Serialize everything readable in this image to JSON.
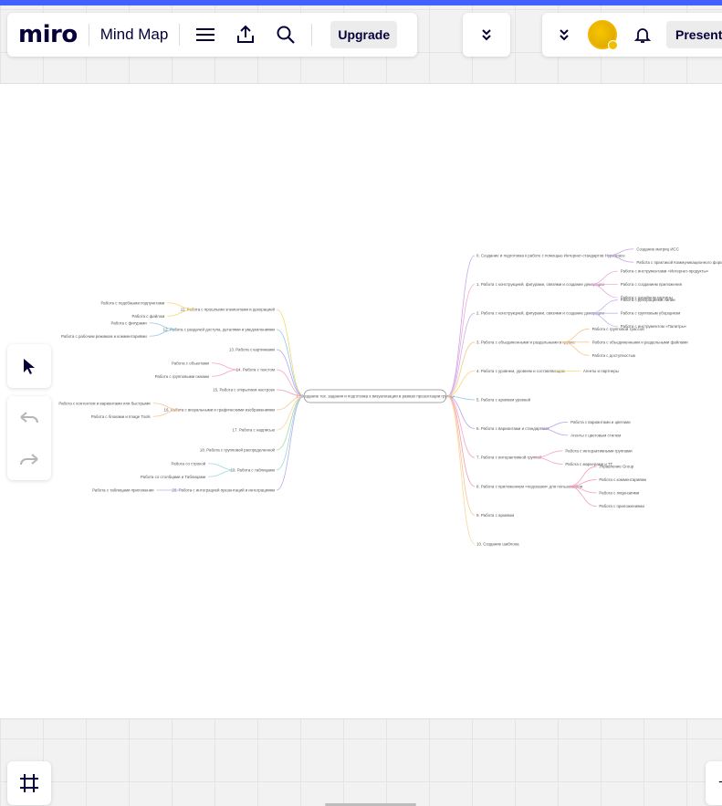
{
  "app": {
    "logo": "miro",
    "board_title": "Mind Map"
  },
  "toolbar": {
    "menu_icon": "hamburger-icon",
    "export_icon": "upload-icon",
    "search_icon": "search-icon",
    "upgrade_label": "Upgrade",
    "collapse_icon": "double-chevron-down-icon"
  },
  "right_toolbar": {
    "collapse_icon": "double-chevron-down-icon",
    "notifications_icon": "bell-icon",
    "present_label": "Present"
  },
  "left_tools": {
    "select_icon": "cursor-icon",
    "undo_icon": "undo-icon",
    "redo_icon": "redo-icon"
  },
  "bottom": {
    "frames_icon": "frames-icon",
    "zoom_label": "+"
  },
  "mindmap": {
    "center": "1. Создание тех. задания и подготовка к визуализации в рамках презентации группы",
    "right": [
      {
        "label": "0. Создание и подготовка к работе с помощью Интернет-стандартов Hypaspace",
        "children": [
          "Создание матриц ИСС",
          "Работа с практикой Коммуникационного формата"
        ]
      },
      {
        "label": "1. Работа с конструкцией, фигурами, связями и создание декорации",
        "children": [
          "Работа с инструментами «Интернет-продукты»",
          "Работа с созданием приложения",
          "Работа с дизайном картины"
        ]
      },
      {
        "label": "2. Работа с конструкцией, фигурами, связями и создание декорации",
        "children": [
          "Работа с декорациями линии",
          "Работа с групповым уборщиком",
          "Работа с инструментом «Палитры»"
        ]
      },
      {
        "label": "3. Работа с объединенными и раздельными в группе",
        "children": [
          "Работа с групповой трассой",
          "Работа с объединенными и раздельными файлами",
          "Работа с доступностью"
        ]
      },
      {
        "label": "4. Работа с уровнем, уровнем и составляющим",
        "children": [
          "Агенты и партнеры"
        ]
      },
      {
        "label": "5. Работа с архивом уровней",
        "children": []
      },
      {
        "label": "6. Работа с вариантами и стандартами",
        "children": [
          "Работа с вариантами и цветами",
          "Агенты с цветовым стилем"
        ]
      },
      {
        "label": "7. Работа с интерактивной группой",
        "children": [
          "Работа с интерактивными группами",
          "Работа с маркерами и ТГ"
        ]
      },
      {
        "label": "8. Работа с приложением «подсказки» для пользователя",
        "children": [
          "Управление Group",
          "Работа с комментариями",
          "Работа с лицензиями",
          "Работа с приложениями"
        ]
      },
      {
        "label": "9. Работа с архивом",
        "children": []
      },
      {
        "label": "10. Создание шаблона",
        "children": []
      }
    ],
    "left": [
      {
        "label": "11. Работа с прошлыми элементами и декорацией",
        "children": [
          "Работа с подобными подпунктами",
          "Работа с файлом"
        ]
      },
      {
        "label": "12. Работа с раздачей доступа, деталями и уведомлениями",
        "children": [
          "Работа с фигурами",
          "Работа с рабочим режимом и комментариями"
        ]
      },
      {
        "label": "13. Работа с картинками",
        "children": []
      },
      {
        "label": "14. Работа с текстом",
        "children": [
          "Работа с объектами",
          "Работа с групповыми окнами"
        ]
      },
      {
        "label": "15. Работа с открытием настроек",
        "children": []
      },
      {
        "label": "16. Работа с визуальными и графическими изображениями",
        "children": [
          "Работа с контентом и вариантами или быстрыми",
          "Работа с блоками и Image Tools"
        ]
      },
      {
        "label": "17. Работа с надписью",
        "children": []
      },
      {
        "label": "18. Работа с групповой распределенной",
        "children": []
      },
      {
        "label": "19. Работа с таблицами",
        "children": [
          "Работа со строкой",
          "Работа со столбцами и Таблицами"
        ]
      },
      {
        "label": "20. Работа с интеграцией презентаций и интеграциями",
        "children": [
          "Работа с таблицами приложения"
        ]
      }
    ],
    "colors": [
      "#c9a6e8",
      "#f2a9d8",
      "#c5b3ef",
      "#f7c78a",
      "#f5d76e",
      "#8ecbe8",
      "#b9a2ea",
      "#f2a2c8",
      "#f59bb8",
      "#f7c590",
      "#fcd79a",
      "#a8d8a0",
      "#9fd6e0",
      "#b7aeee"
    ]
  }
}
